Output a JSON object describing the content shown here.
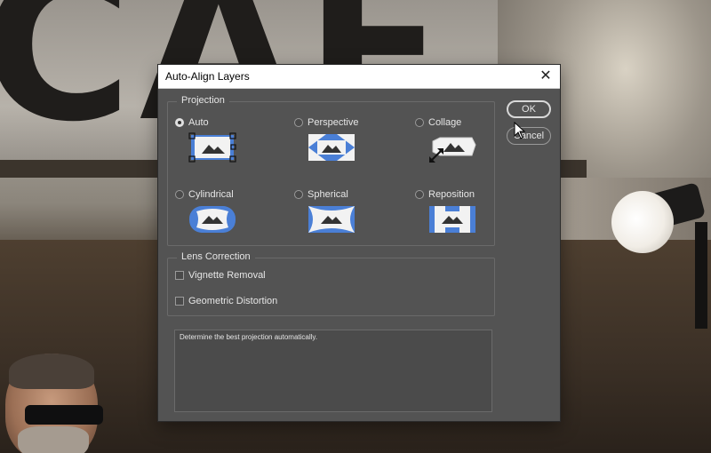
{
  "dialog": {
    "title": "Auto-Align Layers",
    "close_glyph": "✕"
  },
  "projection": {
    "legend": "Projection",
    "selected": "Auto",
    "options": [
      {
        "label": "Auto",
        "icon": "auto-projection-icon"
      },
      {
        "label": "Perspective",
        "icon": "perspective-projection-icon"
      },
      {
        "label": "Collage",
        "icon": "collage-projection-icon"
      },
      {
        "label": "Cylindrical",
        "icon": "cylindrical-projection-icon"
      },
      {
        "label": "Spherical",
        "icon": "spherical-projection-icon"
      },
      {
        "label": "Reposition",
        "icon": "reposition-projection-icon"
      }
    ]
  },
  "lens": {
    "legend": "Lens Correction",
    "vignette_label": "Vignette Removal",
    "vignette_checked": false,
    "geometric_label": "Geometric Distortion",
    "geometric_checked": false
  },
  "description": "Determine the best projection automatically.",
  "buttons": {
    "ok": "OK",
    "cancel": "Cancel"
  },
  "colors": {
    "dialog_bg": "#535353",
    "accent_blue": "#4a7fd6",
    "text": "#e6e6e6"
  }
}
